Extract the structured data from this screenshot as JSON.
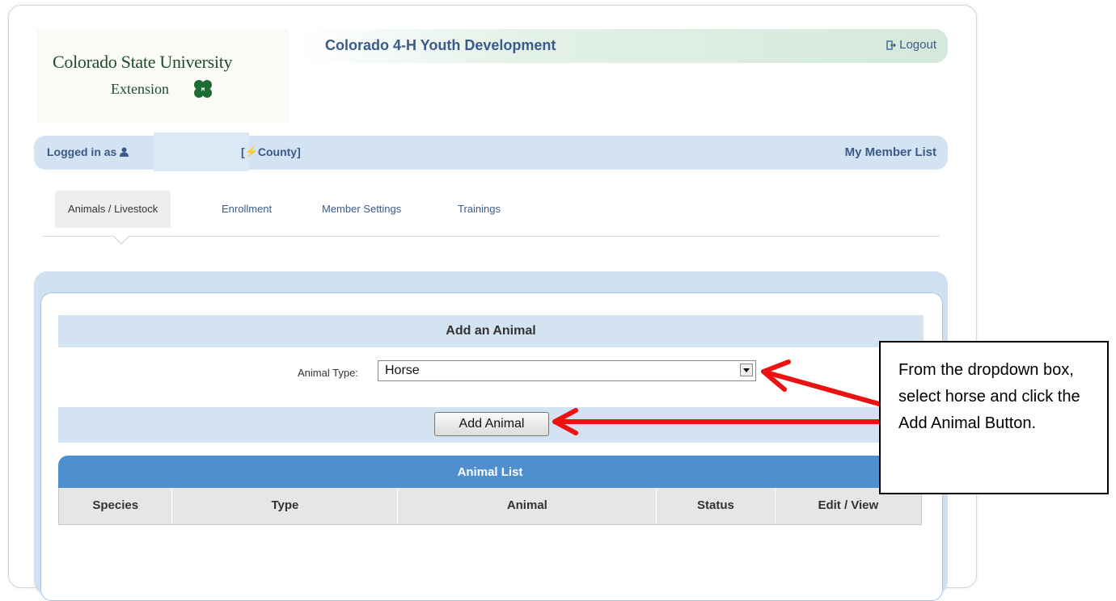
{
  "logo": {
    "line1": "Colorado State University",
    "line2": "Extension",
    "icon": "clover-icon"
  },
  "header": {
    "title": "Colorado 4-H Youth Development",
    "logout_label": "Logout",
    "logout_icon": "logout-icon"
  },
  "userbar": {
    "logged_in_prefix": "Logged in as",
    "user_icon": "user-icon",
    "county_text": "County]",
    "county_prefix": "[",
    "my_member_list": "My Member List"
  },
  "tabs": [
    {
      "label": "Animals / Livestock",
      "active": true
    },
    {
      "label": "Enrollment",
      "active": false
    },
    {
      "label": "Member Settings",
      "active": false
    },
    {
      "label": "Trainings",
      "active": false
    }
  ],
  "add_animal": {
    "heading": "Add an Animal",
    "type_label": "Animal Type:",
    "type_value": "Horse",
    "button_label": "Add Animal"
  },
  "animal_list": {
    "heading": "Animal List",
    "columns": [
      "Species",
      "Type",
      "Animal",
      "Status",
      "Edit / View"
    ]
  },
  "callout": {
    "text": "From the dropdown box, select horse and click the Add Animal Button."
  },
  "colors": {
    "accent_blue": "#4d8fcf",
    "light_blue": "#d4e3f2",
    "link_blue": "#3a5a8c",
    "annotation_red": "#ee1111"
  }
}
